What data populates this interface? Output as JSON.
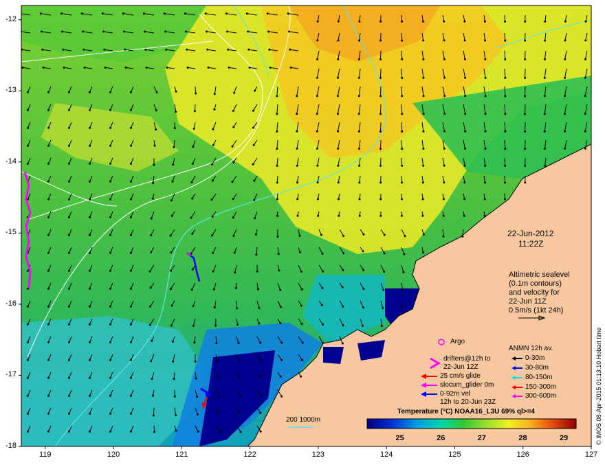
{
  "map": {
    "lat_ticks": [
      "-12",
      "-13",
      "-14",
      "-15",
      "-16",
      "-17",
      "-18"
    ],
    "lon_ticks": [
      "119",
      "120",
      "121",
      "122",
      "123",
      "124",
      "125",
      "126",
      "127"
    ],
    "lat_range": [
      -18,
      -11.8
    ],
    "lon_range": [
      118.65,
      127
    ],
    "colors": {
      "land": "#f7c8a0",
      "sst_cold": "#000090",
      "sst_cool": "#00b4c8",
      "sst_mid": "#2cc44a",
      "sst_warm": "#d8e830",
      "sst_hot": "#f2b020",
      "contour": "#58e6e6",
      "contour_white": "#ffffff",
      "argo": "#ff00ff",
      "drifter": "#ff00ff",
      "glider_red": "#ff0000",
      "glider_blue": "#0000ff"
    }
  },
  "date_block": {
    "date": "22-Jun-2012",
    "time": "11:22Z"
  },
  "altimetry": {
    "line1": "Altimetric sealevel",
    "line2": "(0.1m contours)",
    "line3": "and velocity for",
    "line4": "22-Jun 11Z",
    "line5": "0.5m/s (1kt 24h)"
  },
  "legend_left": {
    "argo": "Argo",
    "drifters_1": "drifters@12h to",
    "drifters_2": "22-Jun 12Z",
    "glide": "25 cm/s glide",
    "slocum": "slocum_glider 0m",
    "vel_1": "0-92m vel",
    "vel_2": "12h to 20-Jun 23Z"
  },
  "legend_anmn": {
    "title": "ANMN 12h av.",
    "items": [
      {
        "label": "0-30m",
        "color": "#000000"
      },
      {
        "label": "30-80m",
        "color": "#0000ff"
      },
      {
        "label": "80-150m",
        "color": "#00e0e0"
      },
      {
        "label": "150-300m",
        "color": "#ff0000"
      },
      {
        "label": "300-600m",
        "color": "#ff00ff"
      }
    ]
  },
  "scale": {
    "contours": "200  1000m"
  },
  "colorbar": {
    "title": "Temperature (°C) NOAA16_L3U 69% ql>=4",
    "ticks": [
      "25",
      "26",
      "27",
      "28",
      "29"
    ],
    "range": [
      24.2,
      29.3
    ]
  },
  "credit": "© IMOS 08-Apr-2015 01:13:10 Hobart time"
}
